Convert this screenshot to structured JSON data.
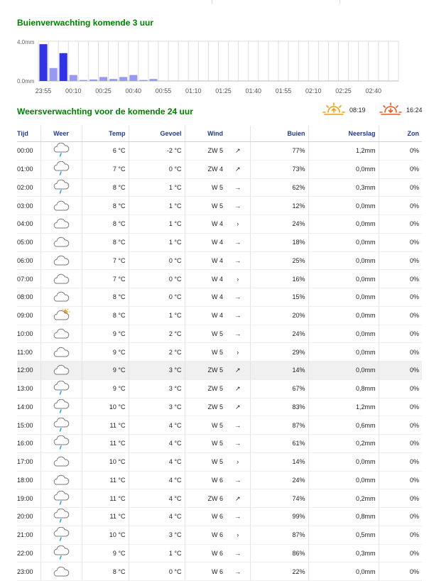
{
  "rain": {
    "title": "Buienverwachting komende 3 uur",
    "y_labels": [
      "4.0mm",
      "0.0mm"
    ],
    "x_labels": [
      "23:55",
      "00:10",
      "00:25",
      "00:40",
      "00:55",
      "01:10",
      "01:25",
      "01:40",
      "01:55",
      "02:10",
      "02:25",
      "02:40"
    ]
  },
  "chart_data": {
    "type": "bar",
    "ylabel": "",
    "xlabel": "",
    "ylim": [
      0,
      4.0
    ],
    "categories": [
      "23:55",
      "00:00",
      "00:05",
      "00:10",
      "00:15",
      "00:20",
      "00:25",
      "00:30",
      "00:35",
      "00:40",
      "00:45",
      "00:50",
      "00:55",
      "01:00",
      "01:05",
      "01:10",
      "01:15",
      "01:20",
      "01:25",
      "01:30",
      "01:35",
      "01:40",
      "01:45",
      "01:50",
      "01:55",
      "02:00",
      "02:05",
      "02:10",
      "02:15",
      "02:20",
      "02:25",
      "02:30",
      "02:35",
      "02:40",
      "02:45",
      "02:50"
    ],
    "values": [
      3.7,
      1.3,
      2.8,
      0.6,
      0.1,
      0.15,
      0.4,
      0.2,
      0.4,
      0.6,
      0.1,
      0.2,
      0,
      0,
      0,
      0,
      0,
      0,
      0,
      0,
      0,
      0,
      0,
      0,
      0,
      0,
      0,
      0,
      0,
      0,
      0,
      0,
      0,
      0,
      0,
      0
    ],
    "colors": {
      "strong": "#3333e6",
      "light": "#9999f2",
      "grid": "#dcdcdc"
    }
  },
  "forecast": {
    "title": "Weersverwachting voor de komende 24 uur",
    "sunrise": "08:19",
    "sunset": "16:24",
    "headers": {
      "tijd": "Tijd",
      "weer": "Weer",
      "temp": "Temp",
      "gevoel": "Gevoel",
      "wind": "Wind",
      "buien": "Buien",
      "neerslag": "Neerslag",
      "zon": "Zon"
    },
    "rows": [
      {
        "time": "00:00",
        "icon": "cloud-rain-icon",
        "temp": "6 °C",
        "feel": "-2 °C",
        "wind": "ZW 5",
        "arrow": "↗",
        "buien": "77%",
        "neer": "1,2mm",
        "zon": "0%"
      },
      {
        "time": "01:00",
        "icon": "cloud-rain-icon",
        "temp": "7 °C",
        "feel": "0 °C",
        "wind": "ZW 4",
        "arrow": "↗",
        "buien": "73%",
        "neer": "0,0mm",
        "zon": "0%"
      },
      {
        "time": "02:00",
        "icon": "cloud-rain-icon",
        "temp": "8 °C",
        "feel": "1 °C",
        "wind": "W 5",
        "arrow": "→",
        "buien": "62%",
        "neer": "0,3mm",
        "zon": "0%"
      },
      {
        "time": "03:00",
        "icon": "cloud-icon",
        "temp": "8 °C",
        "feel": "1 °C",
        "wind": "W 5",
        "arrow": "→",
        "buien": "12%",
        "neer": "0,0mm",
        "zon": "0%"
      },
      {
        "time": "04:00",
        "icon": "cloud-icon",
        "temp": "8 °C",
        "feel": "1 °C",
        "wind": "W 4",
        "arrow": "›",
        "buien": "24%",
        "neer": "0,0mm",
        "zon": "0%"
      },
      {
        "time": "05:00",
        "icon": "cloud-icon",
        "temp": "8 °C",
        "feel": "1 °C",
        "wind": "W 4",
        "arrow": "→",
        "buien": "18%",
        "neer": "0,0mm",
        "zon": "0%"
      },
      {
        "time": "06:00",
        "icon": "cloud-moon-icon",
        "temp": "7 °C",
        "feel": "0 °C",
        "wind": "W 4",
        "arrow": "→",
        "buien": "25%",
        "neer": "0,0mm",
        "zon": "0%"
      },
      {
        "time": "07:00",
        "icon": "cloud-icon",
        "temp": "7 °C",
        "feel": "0 °C",
        "wind": "W 4",
        "arrow": "›",
        "buien": "16%",
        "neer": "0,0mm",
        "zon": "0%"
      },
      {
        "time": "08:00",
        "icon": "cloud-icon",
        "temp": "8 °C",
        "feel": "0 °C",
        "wind": "W 4",
        "arrow": "→",
        "buien": "15%",
        "neer": "0,0mm",
        "zon": "0%"
      },
      {
        "time": "09:00",
        "icon": "cloud-sun-icon",
        "temp": "8 °C",
        "feel": "1 °C",
        "wind": "W 4",
        "arrow": "→",
        "buien": "20%",
        "neer": "0,0mm",
        "zon": "0%"
      },
      {
        "time": "10:00",
        "icon": "cloud-icon",
        "temp": "9 °C",
        "feel": "2 °C",
        "wind": "W 5",
        "arrow": "→",
        "buien": "24%",
        "neer": "0,0mm",
        "zon": "0%"
      },
      {
        "time": "11:00",
        "icon": "cloud-icon",
        "temp": "9 °C",
        "feel": "2 °C",
        "wind": "W 5",
        "arrow": "›",
        "buien": "29%",
        "neer": "0,0mm",
        "zon": "0%"
      },
      {
        "time": "12:00",
        "icon": "cloud-icon",
        "temp": "9 °C",
        "feel": "3 °C",
        "wind": "ZW 5",
        "arrow": "↗",
        "buien": "14%",
        "neer": "0,0mm",
        "zon": "0%",
        "hl": true
      },
      {
        "time": "13:00",
        "icon": "cloud-rain-icon",
        "temp": "9 °C",
        "feel": "3 °C",
        "wind": "ZW 5",
        "arrow": "↗",
        "buien": "67%",
        "neer": "0,8mm",
        "zon": "0%"
      },
      {
        "time": "14:00",
        "icon": "cloud-rain-icon",
        "temp": "10 °C",
        "feel": "3 °C",
        "wind": "ZW 5",
        "arrow": "↗",
        "buien": "83%",
        "neer": "1,2mm",
        "zon": "0%"
      },
      {
        "time": "15:00",
        "icon": "cloud-rain-icon",
        "temp": "11 °C",
        "feel": "4 °C",
        "wind": "W 5",
        "arrow": "→",
        "buien": "87%",
        "neer": "0,6mm",
        "zon": "0%"
      },
      {
        "time": "16:00",
        "icon": "cloud-rain-icon",
        "temp": "11 °C",
        "feel": "4 °C",
        "wind": "W 5",
        "arrow": "→",
        "buien": "61%",
        "neer": "0,2mm",
        "zon": "0%"
      },
      {
        "time": "17:00",
        "icon": "cloud-icon",
        "temp": "10 °C",
        "feel": "4 °C",
        "wind": "W 5",
        "arrow": "›",
        "buien": "14%",
        "neer": "0,0mm",
        "zon": "0%"
      },
      {
        "time": "18:00",
        "icon": "cloud-icon",
        "temp": "11 °C",
        "feel": "4 °C",
        "wind": "W 6",
        "arrow": "→",
        "buien": "24%",
        "neer": "0,0mm",
        "zon": "0%"
      },
      {
        "time": "19:00",
        "icon": "cloud-rain-icon",
        "temp": "11 °C",
        "feel": "4 °C",
        "wind": "ZW 6",
        "arrow": "↗",
        "buien": "74%",
        "neer": "0,2mm",
        "zon": "0%"
      },
      {
        "time": "20:00",
        "icon": "cloud-rain-icon",
        "temp": "11 °C",
        "feel": "4 °C",
        "wind": "W 6",
        "arrow": "→",
        "buien": "99%",
        "neer": "0,8mm",
        "zon": "0%"
      },
      {
        "time": "21:00",
        "icon": "cloud-rain-icon",
        "temp": "10 °C",
        "feel": "3 °C",
        "wind": "W 6",
        "arrow": "›",
        "buien": "87%",
        "neer": "0,5mm",
        "zon": "0%"
      },
      {
        "time": "22:00",
        "icon": "cloud-rain-icon",
        "temp": "9 °C",
        "feel": "1 °C",
        "wind": "W 6",
        "arrow": "→",
        "buien": "86%",
        "neer": "0,3mm",
        "zon": "0%"
      },
      {
        "time": "23:00",
        "icon": "cloud-icon",
        "temp": "8 °C",
        "feel": "0 °C",
        "wind": "W 6",
        "arrow": "→",
        "buien": "22%",
        "neer": "0,0mm",
        "zon": "0%"
      }
    ]
  }
}
